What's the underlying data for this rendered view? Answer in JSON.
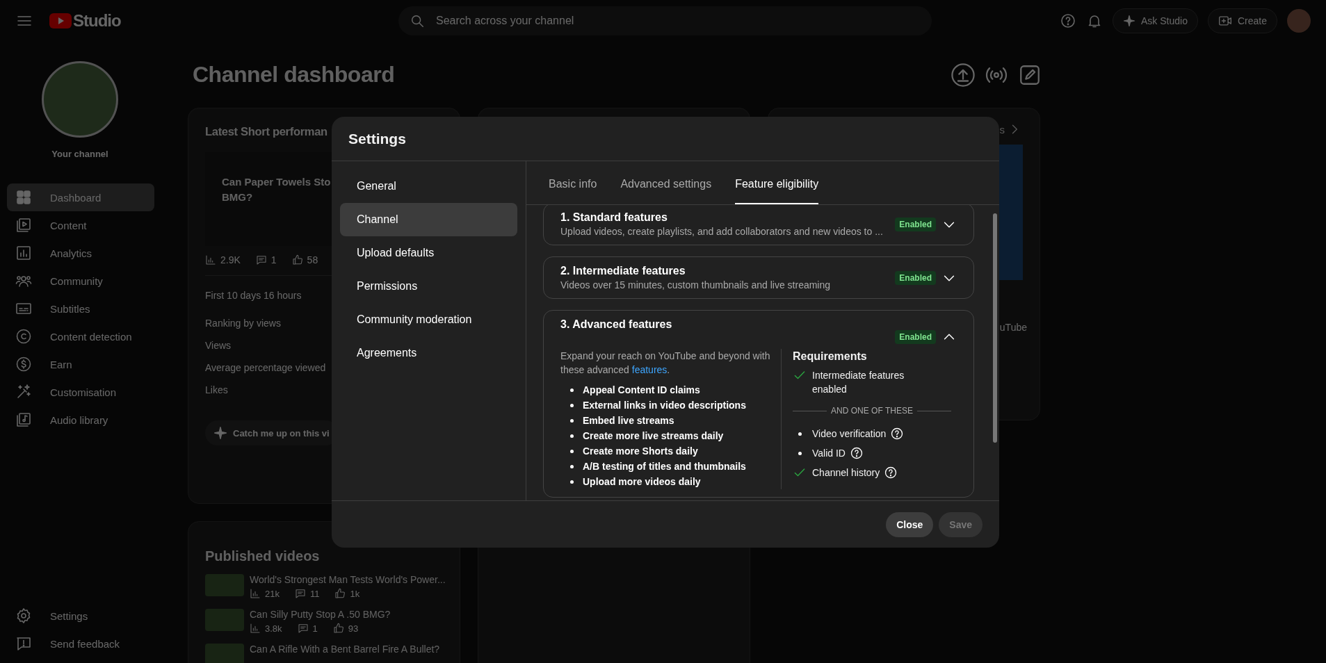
{
  "header": {
    "logo_text": "Studio",
    "search": {
      "placeholder": "Search across your channel"
    },
    "ask_button": "Ask Studio",
    "create_button": "Create"
  },
  "sidebar": {
    "channel_label": "Your channel",
    "items": [
      {
        "label": "Dashboard",
        "selected": true
      },
      {
        "label": "Content",
        "selected": false
      },
      {
        "label": "Analytics",
        "selected": false
      },
      {
        "label": "Community",
        "selected": false
      },
      {
        "label": "Subtitles",
        "selected": false
      },
      {
        "label": "Content detection",
        "selected": false
      },
      {
        "label": "Earn",
        "selected": false
      },
      {
        "label": "Customisation",
        "selected": false
      },
      {
        "label": "Audio library",
        "selected": false
      }
    ],
    "footer_items": [
      {
        "label": "Settings"
      },
      {
        "label": "Send feedback"
      }
    ]
  },
  "page_title": "Channel dashboard",
  "short_card": {
    "title": "Latest Short performan",
    "video_title_lines": [
      "Can Paper Towels Sto",
      "BMG?"
    ],
    "stats": [
      "2.9K",
      "1",
      "58"
    ],
    "period": "First 10 days 16 hours",
    "rows": [
      "Ranking by views",
      "Views",
      "Average percentage viewed",
      "Likes"
    ],
    "catch_up_button": "Catch me up on this vi"
  },
  "right_card": {
    "header_fragment": "s",
    "body_fragment": "uTube"
  },
  "published_card": {
    "title": "Published videos",
    "videos": [
      {
        "title": "World's Strongest Man Tests World's Power...",
        "stats": [
          "21k",
          "11",
          "1k"
        ]
      },
      {
        "title": "Can Silly Putty Stop A .50 BMG?",
        "stats": [
          "3.8k",
          "1",
          "93"
        ]
      },
      {
        "title": "Can A Rifle With a Bent Barrel Fire A Bullet?"
      }
    ]
  },
  "modal": {
    "title": "Settings",
    "nav": [
      {
        "label": "General",
        "selected": false
      },
      {
        "label": "Channel",
        "selected": true
      },
      {
        "label": "Upload defaults",
        "selected": false
      },
      {
        "label": "Permissions",
        "selected": false
      },
      {
        "label": "Community moderation",
        "selected": false
      },
      {
        "label": "Agreements",
        "selected": false
      }
    ],
    "tabs": [
      {
        "label": "Basic info",
        "selected": false
      },
      {
        "label": "Advanced settings",
        "selected": false
      },
      {
        "label": "Feature eligibility",
        "selected": true
      }
    ],
    "features": [
      {
        "title": "1. Standard features",
        "subtitle": "Upload videos, create playlists, and add collaborators and new videos to ...",
        "status": "Enabled",
        "expanded": false
      },
      {
        "title": "2. Intermediate features",
        "subtitle": "Videos over 15 minutes, custom thumbnails and live streaming",
        "status": "Enabled",
        "expanded": false
      },
      {
        "title": "3. Advanced features",
        "status": "Enabled",
        "expanded": true,
        "description": "Expand your reach on YouTube and beyond with these advanced",
        "link_text": "features",
        "description_end": ".",
        "benefits": [
          "Appeal Content ID claims",
          "External links in video descriptions",
          "Embed live streams",
          "Create more live streams daily",
          "Create more Shorts daily",
          "A/B testing of titles and thumbnails",
          "Upload more videos daily"
        ],
        "requirements": {
          "title": "Requirements",
          "items": [
            {
              "kind": "item",
              "label": "Intermediate features enabled",
              "met": true,
              "help": false
            },
            {
              "kind": "separator",
              "label": "AND ONE OF THESE"
            },
            {
              "kind": "item",
              "label": "Video verification",
              "met": false,
              "help": true
            },
            {
              "kind": "item",
              "label": "Valid ID",
              "met": false,
              "help": true
            },
            {
              "kind": "item",
              "label": "Channel history",
              "met": true,
              "help": true
            }
          ]
        }
      }
    ],
    "buttons": [
      {
        "label": "Close",
        "disabled": false
      },
      {
        "label": "Save",
        "disabled": true
      }
    ]
  }
}
